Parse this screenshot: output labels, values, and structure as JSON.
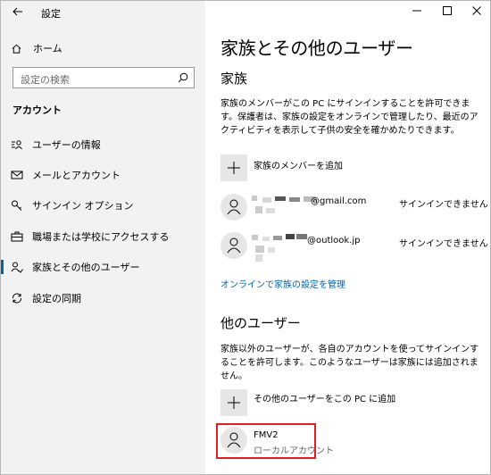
{
  "window": {
    "title": "設定"
  },
  "sidebar": {
    "home_label": "ホーム",
    "search_placeholder": "設定の検索",
    "section_title": "アカウント",
    "items": [
      {
        "label": "ユーザーの情報",
        "icon": "user-info-icon"
      },
      {
        "label": "メールとアカウント",
        "icon": "mail-icon"
      },
      {
        "label": "サインイン オプション",
        "icon": "key-icon"
      },
      {
        "label": "職場または学校にアクセスする",
        "icon": "briefcase-icon"
      },
      {
        "label": "家族とその他のユーザー",
        "icon": "people-icon",
        "active": true
      },
      {
        "label": "設定の同期",
        "icon": "sync-icon"
      }
    ]
  },
  "main": {
    "title": "家族とその他のユーザー",
    "family": {
      "heading": "家族",
      "description": "家族のメンバーがこの PC にサインインすることを許可できます。保護者は、家族の設定をオンラインで管理したり、最近のアクティビティを表示して子供の安全を確かめたりできます。",
      "add_label": "家族のメンバーを追加",
      "members": [
        {
          "email_suffix": "@gmail.com",
          "status": "サインインできません"
        },
        {
          "email_suffix": "@outlook.jp",
          "status": "サインインできません"
        }
      ],
      "manage_link": "オンラインで家族の設定を管理"
    },
    "others": {
      "heading": "他のユーザー",
      "description": "家族以外のユーザーが、各自のアカウントを使ってサインインすることを許可します。このようなユーザーは家族には追加されません。",
      "add_label": "その他のユーザーをこの PC に追加",
      "user": {
        "name": "FMV2",
        "type": "ローカルアカウント"
      }
    }
  },
  "colors": {
    "accent": "#0063b1",
    "highlight": "#e01e24",
    "sidebar_bg": "#f2f2f2"
  }
}
